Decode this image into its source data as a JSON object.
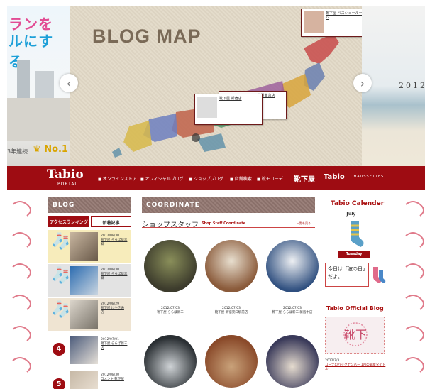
{
  "hero": {
    "left_tagline_1": "ランを",
    "left_tagline_2": "ルにする。",
    "left_award": "3年連続",
    "left_no1": "No.1",
    "map_title": "BLOG MAP",
    "year": "2012",
    "popups": [
      {
        "text": "靴下屋 バスショールーム"
      },
      {
        "text": "Tabio 名古屋東急店"
      },
      {
        "text": "靴下屋 新宿店"
      }
    ]
  },
  "navbar": {
    "logo": "Tabio",
    "logo_sub": "PORTAL",
    "items": [
      "オンラインストア",
      "オフィシャルブログ",
      "ショップブログ",
      "店舗検索",
      "靴モコーデ"
    ],
    "brands": [
      "靴下屋",
      "Tabio",
      "CHAUSSETTES"
    ]
  },
  "blog": {
    "heading": "BLOG",
    "tabs": [
      "アクセスランキング",
      "新着記事"
    ],
    "items": [
      {
        "rank": "1",
        "date": "2012/08/30",
        "shop": "靴下屋 ららぽ新三",
        "title": "郷"
      },
      {
        "rank": "2",
        "date": "2012/08/30",
        "shop": "靴下屋 ららぽ新三",
        "title": "郷"
      },
      {
        "rank": "3",
        "date": "2012/08/29",
        "shop": "靴下屋 けやき通",
        "title": "店"
      },
      {
        "rank": "4",
        "date": "2012/07/01",
        "shop": "靴下屋 ららぽ新三",
        "title": "店"
      },
      {
        "rank": "5",
        "date": "2012/08/30",
        "shop": "コメント 靴下屋",
        "title": ""
      }
    ]
  },
  "coordinate": {
    "heading": "COORDINATE",
    "title": "ショップスタッフ",
    "subtitle": "Shop Staff Coordinate",
    "more": "一覧を見る",
    "items": [
      {
        "date": "2012/07/03",
        "caption": "靴下屋 ららぽ新三"
      },
      {
        "date": "2012/07/03",
        "caption": "靴下屋 新宿東口駅前店"
      },
      {
        "date": "2012/07/03",
        "caption": "靴下屋 ららぽ新三 新宿中店"
      },
      {
        "date": "",
        "caption": ""
      },
      {
        "date": "",
        "caption": ""
      },
      {
        "date": "",
        "caption": ""
      }
    ]
  },
  "calendar": {
    "title": "Tabio Calender",
    "month": "July",
    "weekday": "Tuesday",
    "note": "今日は「波の日」だよ。"
  },
  "official_blog": {
    "title": "Tabio Official Blog",
    "date": "2012/7/3",
    "text": "コーデのバックナンバー 1月の最新タイトル"
  },
  "colors": {
    "brand_red": "#9e0c12",
    "section_brown": "#8a706a",
    "accent_gold": "#d9a400"
  }
}
